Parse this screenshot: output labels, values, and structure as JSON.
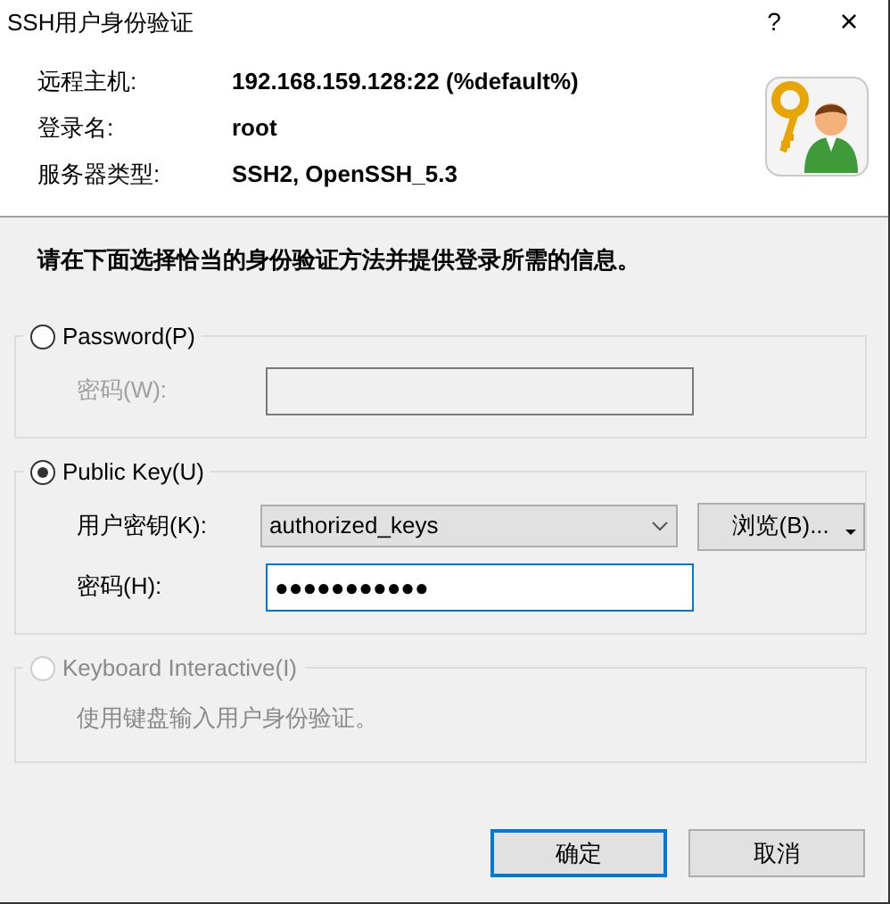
{
  "window": {
    "title": "SSH用户身份验证",
    "help": "?",
    "close": "×"
  },
  "info": [
    {
      "label": "远程主机:",
      "value": "192.168.159.128:22 (%default%)"
    },
    {
      "label": "登录名:",
      "value": "root"
    },
    {
      "label": "服务器类型:",
      "value": "SSH2, OpenSSH_5.3"
    }
  ],
  "instruction": "请在下面选择恰当的身份验证方法并提供登录所需的信息。",
  "methods": [
    {
      "kind": "password",
      "label": "Password(P)",
      "selected": false,
      "disabled": false,
      "fields": [
        {
          "kind": "text",
          "label": "密码(W):",
          "disabled": true
        }
      ]
    },
    {
      "kind": "publickey",
      "label": "Public Key(U)",
      "selected": true,
      "disabled": false,
      "fields": [
        {
          "kind": "combo",
          "label": "用户密钥(K):",
          "value": "authorized_keys",
          "button": "浏览(B)..."
        },
        {
          "kind": "text",
          "label": "密码(H):",
          "value": "●●●●●●●●●●●",
          "disabled": false,
          "focused": true
        }
      ]
    },
    {
      "kind": "keyboard",
      "label": "Keyboard Interactive(I)",
      "selected": false,
      "disabled": true,
      "note": "使用键盘输入用户身份验证。"
    }
  ],
  "buttons": [
    {
      "label": "确定",
      "default": true
    },
    {
      "label": "取消",
      "default": false
    }
  ]
}
